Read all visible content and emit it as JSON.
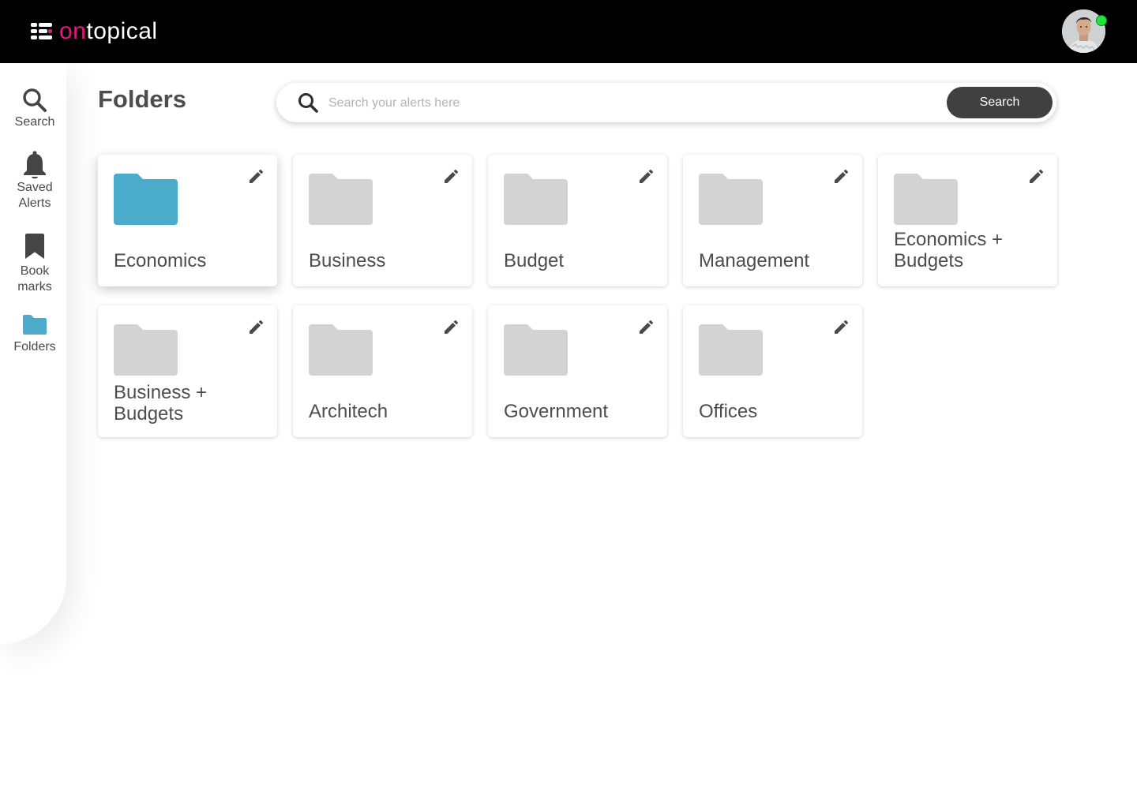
{
  "app": {
    "logo_on": "on",
    "logo_rest": "topical"
  },
  "colors": {
    "brand_pink": "#e8157e",
    "active_blue": "#4aabcb",
    "inactive_gray": "#d3d3d3",
    "button_dark": "#404040",
    "online_green": "#22e53a"
  },
  "header": {
    "avatar_icon": "user-avatar",
    "status": "online"
  },
  "sidebar": {
    "items": [
      {
        "label": "Search",
        "icon": "search-icon"
      },
      {
        "label": "Saved\nAlerts",
        "icon": "bell-icon"
      },
      {
        "label": "Book\nmarks",
        "icon": "bookmark-icon"
      },
      {
        "label": "Folders",
        "icon": "folder-icon",
        "active": true
      }
    ]
  },
  "main": {
    "title": "Folders",
    "search": {
      "placeholder": "Search your alerts here",
      "button_label": "Search"
    },
    "folders": [
      {
        "name": "Economics",
        "active": true
      },
      {
        "name": "Business"
      },
      {
        "name": "Budget"
      },
      {
        "name": "Management"
      },
      {
        "name": "Economics + Budgets"
      },
      {
        "name": "Business + Budgets"
      },
      {
        "name": "Architech"
      },
      {
        "name": "Government"
      },
      {
        "name": "Offices"
      }
    ]
  }
}
